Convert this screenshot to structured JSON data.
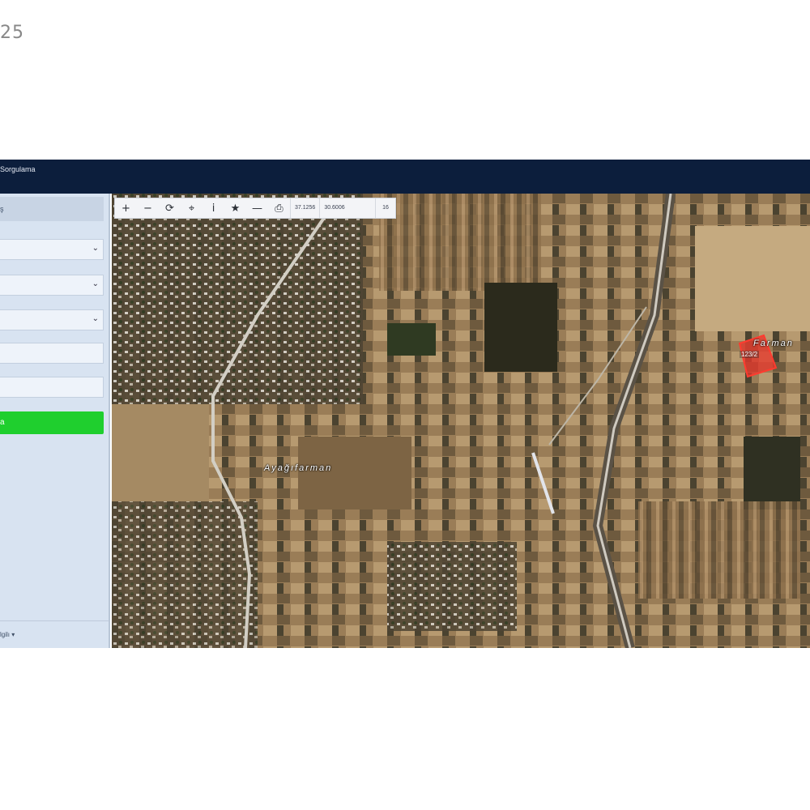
{
  "page": {
    "corner_text": "25"
  },
  "header": {
    "brand": "Sorgulama"
  },
  "sidebar": {
    "tab_label": "ş",
    "fields": [
      "",
      "",
      "",
      "",
      ""
    ],
    "query_button": "a",
    "footer_link": "lgilı ▾"
  },
  "toolbar": {
    "tools": [
      {
        "icon": "zoom-in-icon",
        "glyph": "+"
      },
      {
        "icon": "zoom-out-icon",
        "glyph": "−"
      },
      {
        "icon": "refresh-icon",
        "glyph": "⟳"
      },
      {
        "icon": "locate-icon",
        "glyph": "⌖"
      },
      {
        "icon": "info-icon",
        "glyph": "i"
      },
      {
        "icon": "star-icon",
        "glyph": "★"
      },
      {
        "icon": "measure-icon",
        "glyph": "—"
      },
      {
        "icon": "print-icon",
        "glyph": "⎙"
      }
    ],
    "lat": "37.1256",
    "lon": "30.6006",
    "zoom": "16"
  },
  "map": {
    "labels": [
      "Ayağıfarman",
      "Farman"
    ],
    "parcel": "123/2",
    "parcel_color": "#e8362b"
  },
  "colors": {
    "header_bg": "#0c1e3c",
    "sidebar_bg": "#d8e3f1",
    "button_green": "#1fcf2e"
  }
}
